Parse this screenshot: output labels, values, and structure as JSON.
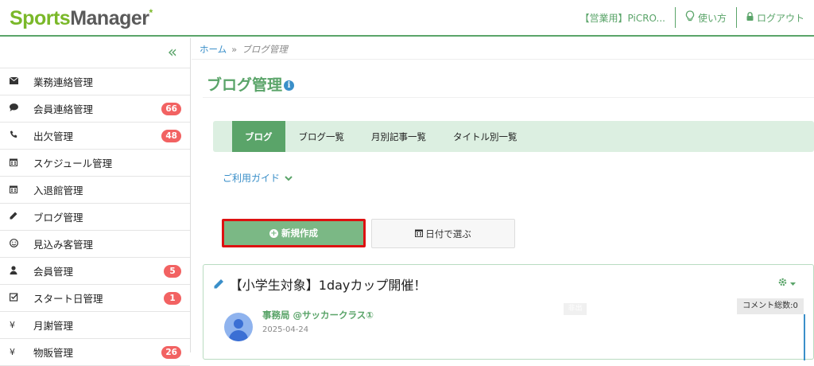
{
  "header": {
    "logo_part1": "Sports",
    "logo_part2": "Manager",
    "logo_star": "*",
    "account": "【営業用】PiCRO...",
    "help": "使い方",
    "logout": "ログアウト"
  },
  "sidebar": {
    "collapse": "«",
    "items": [
      {
        "label": "業務連絡管理",
        "icon": "envelope-icon",
        "badge": ""
      },
      {
        "label": "会員連絡管理",
        "icon": "comment-icon",
        "badge": "66"
      },
      {
        "label": "出欠管理",
        "icon": "phone-icon",
        "badge": "48"
      },
      {
        "label": "スケジュール管理",
        "icon": "calendar-icon",
        "badge": ""
      },
      {
        "label": "入退館管理",
        "icon": "calendar-icon",
        "badge": ""
      },
      {
        "label": "ブログ管理",
        "icon": "pencil-icon",
        "badge": ""
      },
      {
        "label": "見込み客管理",
        "icon": "smile-icon",
        "badge": ""
      },
      {
        "label": "会員管理",
        "icon": "user-icon",
        "badge": "5"
      },
      {
        "label": "スタート日管理",
        "icon": "check-square-icon",
        "badge": "1"
      },
      {
        "label": "月謝管理",
        "icon": "yen-icon",
        "badge": ""
      },
      {
        "label": "物販管理",
        "icon": "yen-icon",
        "badge": "26"
      }
    ]
  },
  "breadcrumb": {
    "home": "ホーム",
    "sep": "»",
    "current": "ブログ管理"
  },
  "page_title": "ブログ管理",
  "tabs": [
    {
      "label": "ブログ",
      "active": true
    },
    {
      "label": "ブログ一覧",
      "active": false
    },
    {
      "label": "月別記事一覧",
      "active": false
    },
    {
      "label": "タイトル別一覧",
      "active": false
    }
  ],
  "guide": "ご利用ガイド",
  "buttons": {
    "new": "新規作成",
    "date": "日付で選ぶ"
  },
  "post": {
    "title": "【小学生対象】1dayカップ開催！",
    "comment_count": "コメント総数:0",
    "hidden_tag": "非出",
    "author": "事務局 @サッカークラス①",
    "date": "2025-04-24"
  }
}
